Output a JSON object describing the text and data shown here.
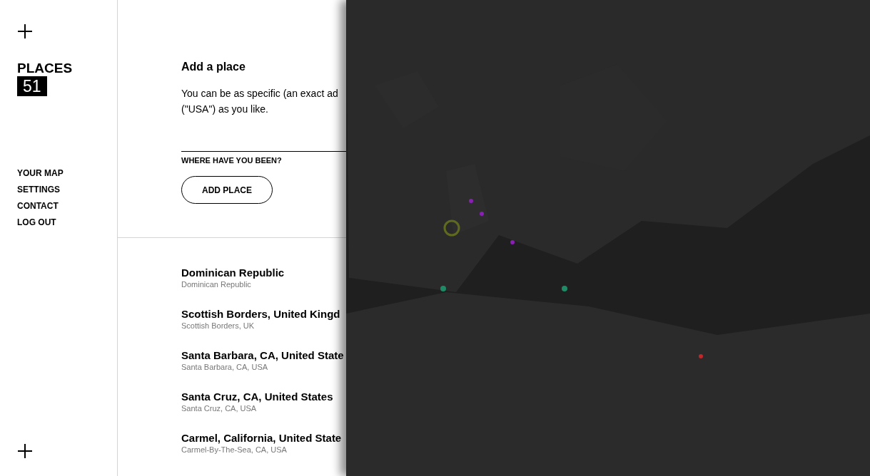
{
  "sidebar": {
    "title": "PLACES",
    "count": "51",
    "nav": [
      {
        "label": "YOUR MAP"
      },
      {
        "label": "SETTINGS"
      },
      {
        "label": "CONTACT"
      },
      {
        "label": "LOG OUT"
      }
    ]
  },
  "add_place": {
    "title": "Add a place",
    "description_lines": [
      "You can be as specific (an exact ad",
      "(\"USA\") as you like."
    ],
    "field_label": "WHERE HAVE YOU BEEN?",
    "button": "ADD PLACE"
  },
  "places": [
    {
      "name": "Dominican Republic",
      "detail": "Dominican Republic"
    },
    {
      "name": "Scottish Borders, United Kingd",
      "detail": "Scottish Borders, UK"
    },
    {
      "name": "Santa Barbara, CA, United State",
      "detail": "Santa Barbara, CA, USA"
    },
    {
      "name": "Santa Cruz, CA, United States",
      "detail": "Santa Cruz, CA, USA"
    },
    {
      "name": "Carmel, California, United State",
      "detail": "Carmel-By-The-Sea, CA, USA"
    }
  ]
}
